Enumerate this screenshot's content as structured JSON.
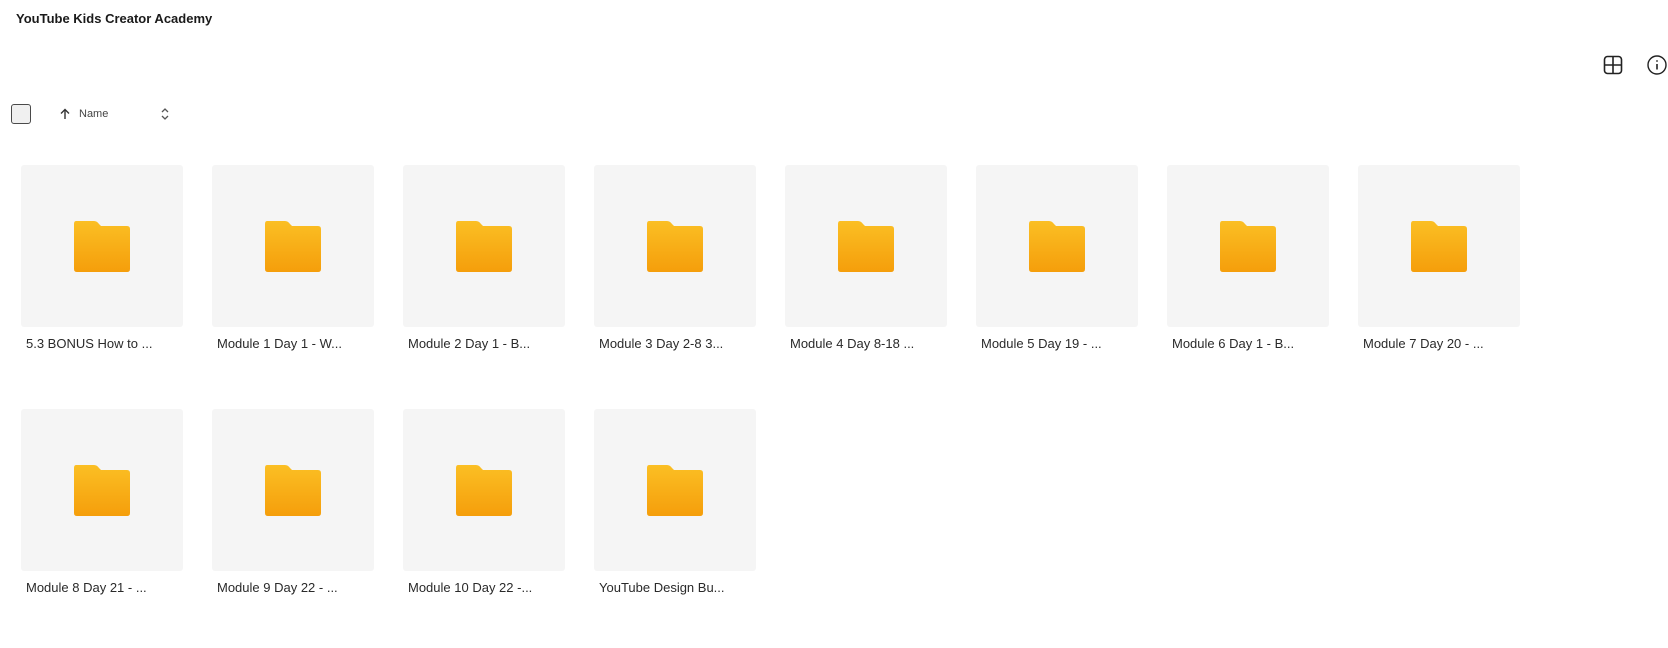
{
  "header": {
    "title": "YouTube Kids Creator Academy"
  },
  "toolbar": {
    "sort_label": "Name",
    "sort_direction": "ascending"
  },
  "icons": {
    "view_toggle": "grid-view-icon",
    "info": "info-icon",
    "sort_arrow": "arrow-up-icon",
    "sort_toggle": "chevron-up-down-icon",
    "folder": "folder-icon"
  },
  "colors": {
    "folder_top": "#FBBF24",
    "folder_bottom": "#F59E0B",
    "tile_bg": "#F5F5F5"
  },
  "folders": [
    {
      "name": "5.3 BONUS How to ..."
    },
    {
      "name": "Module 1 Day 1 - W..."
    },
    {
      "name": "Module 2 Day 1 - B..."
    },
    {
      "name": "Module 3 Day 2-8 3..."
    },
    {
      "name": "Module 4 Day 8-18 ..."
    },
    {
      "name": "Module 5 Day 19 - ..."
    },
    {
      "name": "Module 6 Day 1 - B..."
    },
    {
      "name": "Module 7 Day 20 - ..."
    },
    {
      "name": "Module 8 Day 21 - ..."
    },
    {
      "name": "Module 9 Day 22 - ..."
    },
    {
      "name": "Module 10 Day 22 -..."
    },
    {
      "name": "YouTube Design Bu..."
    }
  ]
}
